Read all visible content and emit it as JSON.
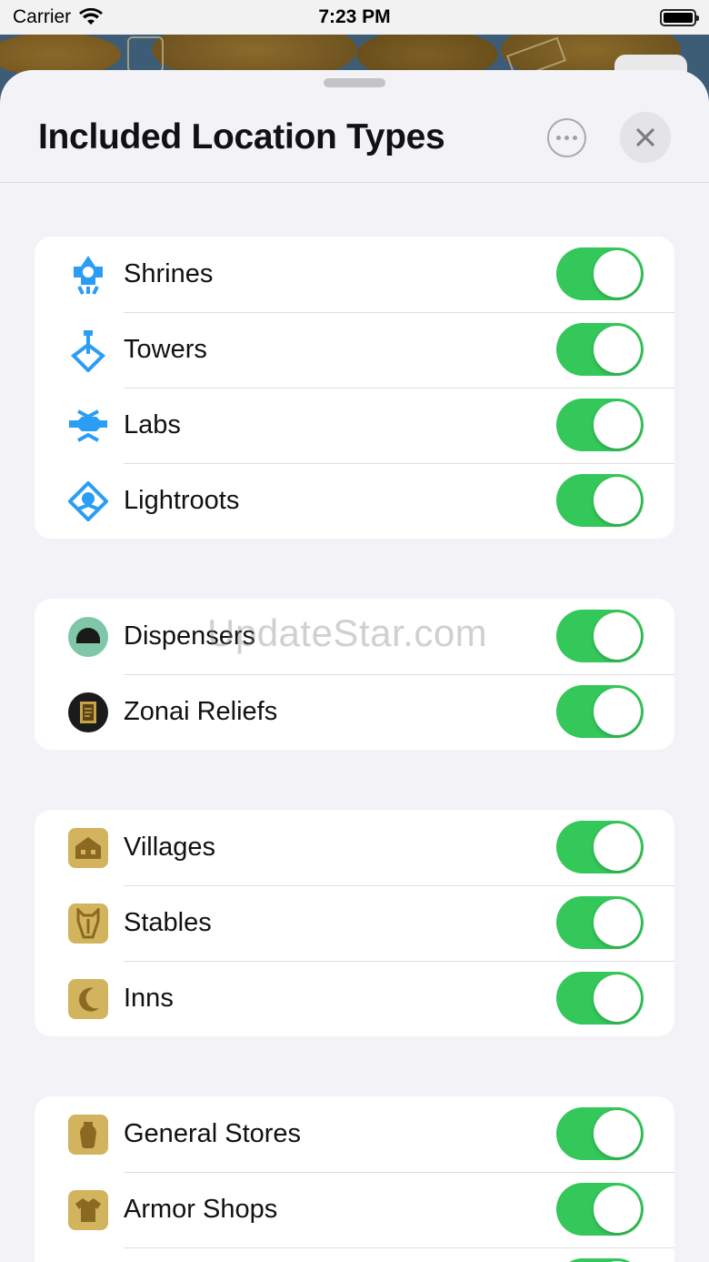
{
  "status_bar": {
    "carrier": "Carrier",
    "time": "7:23 PM"
  },
  "sheet": {
    "title": "Included Location Types",
    "more_icon": "ellipsis-circle-icon",
    "close_icon": "close-icon"
  },
  "colors": {
    "toggle_on": "#34c759",
    "shrine_blue": "#2a9df4",
    "gold_tile": "#d2b45e"
  },
  "groups": [
    {
      "items": [
        {
          "label": "Shrines",
          "icon": "shrine-icon",
          "on": true
        },
        {
          "label": "Towers",
          "icon": "tower-icon",
          "on": true
        },
        {
          "label": "Labs",
          "icon": "lab-icon",
          "on": true
        },
        {
          "label": "Lightroots",
          "icon": "lightroot-icon",
          "on": true
        }
      ]
    },
    {
      "items": [
        {
          "label": "Dispensers",
          "icon": "dispenser-icon",
          "on": true
        },
        {
          "label": "Zonai Reliefs",
          "icon": "zonai-relief-icon",
          "on": true
        }
      ]
    },
    {
      "items": [
        {
          "label": "Villages",
          "icon": "village-icon",
          "on": true
        },
        {
          "label": "Stables",
          "icon": "stable-icon",
          "on": true
        },
        {
          "label": "Inns",
          "icon": "inn-icon",
          "on": true
        }
      ]
    },
    {
      "items": [
        {
          "label": "General Stores",
          "icon": "general-store-icon",
          "on": true
        },
        {
          "label": "Armor Shops",
          "icon": "armor-shop-icon",
          "on": true
        },
        {
          "label": "",
          "icon": "",
          "on": true
        }
      ]
    }
  ],
  "watermark": "UpdateStar.com"
}
